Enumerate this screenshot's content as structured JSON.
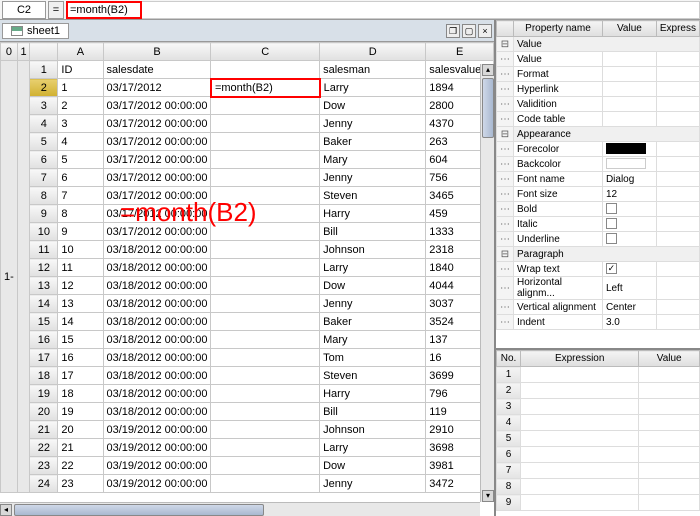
{
  "formula_bar": {
    "cell_ref": "C2",
    "eq": "=",
    "formula": "=month(B2)"
  },
  "sheet_tab": "sheet1",
  "overlay": "=month(B2)",
  "col_headers": [
    "A",
    "B",
    "C",
    "D",
    "E"
  ],
  "outline_headers": [
    "0",
    "1"
  ],
  "header_row": {
    "row": "1",
    "A": "ID",
    "B": "salesdate",
    "C": "",
    "D": "salesman",
    "E": "salesvalue"
  },
  "rows": [
    {
      "n": "2",
      "A": "1",
      "B": "03/17/2012",
      "C": "=month(B2)",
      "D": "Larry",
      "E": "1894"
    },
    {
      "n": "3",
      "A": "2",
      "B": "03/17/2012 00:00:00",
      "C": "",
      "D": "Dow",
      "E": "2800"
    },
    {
      "n": "4",
      "A": "3",
      "B": "03/17/2012 00:00:00",
      "C": "",
      "D": "Jenny",
      "E": "4370"
    },
    {
      "n": "5",
      "A": "4",
      "B": "03/17/2012 00:00:00",
      "C": "",
      "D": "Baker",
      "E": "263"
    },
    {
      "n": "6",
      "A": "5",
      "B": "03/17/2012 00:00:00",
      "C": "",
      "D": "Mary",
      "E": "604"
    },
    {
      "n": "7",
      "A": "6",
      "B": "03/17/2012 00:00:00",
      "C": "",
      "D": "Jenny",
      "E": "756"
    },
    {
      "n": "8",
      "A": "7",
      "B": "03/17/2012 00:00:00",
      "C": "",
      "D": "Steven",
      "E": "3465"
    },
    {
      "n": "9",
      "A": "8",
      "B": "03/17/2012 00:00:00",
      "C": "",
      "D": "Harry",
      "E": "459"
    },
    {
      "n": "10",
      "A": "9",
      "B": "03/17/2012 00:00:00",
      "C": "",
      "D": "Bill",
      "E": "1333"
    },
    {
      "n": "11",
      "A": "10",
      "B": "03/18/2012 00:00:00",
      "C": "",
      "D": "Johnson",
      "E": "2318"
    },
    {
      "n": "12",
      "A": "11",
      "B": "03/18/2012 00:00:00",
      "C": "",
      "D": "Larry",
      "E": "1840"
    },
    {
      "n": "13",
      "A": "12",
      "B": "03/18/2012 00:00:00",
      "C": "",
      "D": "Dow",
      "E": "4044"
    },
    {
      "n": "14",
      "A": "13",
      "B": "03/18/2012 00:00:00",
      "C": "",
      "D": "Jenny",
      "E": "3037"
    },
    {
      "n": "15",
      "A": "14",
      "B": "03/18/2012 00:00:00",
      "C": "",
      "D": "Baker",
      "E": "3524"
    },
    {
      "n": "16",
      "A": "15",
      "B": "03/18/2012 00:00:00",
      "C": "",
      "D": "Mary",
      "E": "137"
    },
    {
      "n": "17",
      "A": "16",
      "B": "03/18/2012 00:00:00",
      "C": "",
      "D": "Tom",
      "E": "16"
    },
    {
      "n": "18",
      "A": "17",
      "B": "03/18/2012 00:00:00",
      "C": "",
      "D": "Steven",
      "E": "3699"
    },
    {
      "n": "19",
      "A": "18",
      "B": "03/18/2012 00:00:00",
      "C": "",
      "D": "Harry",
      "E": "796"
    },
    {
      "n": "20",
      "A": "19",
      "B": "03/18/2012 00:00:00",
      "C": "",
      "D": "Bill",
      "E": "119"
    },
    {
      "n": "21",
      "A": "20",
      "B": "03/19/2012 00:00:00",
      "C": "",
      "D": "Johnson",
      "E": "2910"
    },
    {
      "n": "22",
      "A": "21",
      "B": "03/19/2012 00:00:00",
      "C": "",
      "D": "Larry",
      "E": "3698"
    },
    {
      "n": "23",
      "A": "22",
      "B": "03/19/2012 00:00:00",
      "C": "",
      "D": "Dow",
      "E": "3981"
    },
    {
      "n": "24",
      "A": "23",
      "B": "03/19/2012 00:00:00",
      "C": "",
      "D": "Jenny",
      "E": "3472"
    }
  ],
  "props": {
    "headers": [
      "Property name",
      "Value",
      "Express"
    ],
    "groups": [
      {
        "label": "Value",
        "items": [
          {
            "name": "Value",
            "val": ""
          },
          {
            "name": "Format",
            "val": ""
          },
          {
            "name": "Hyperlink",
            "val": ""
          },
          {
            "name": "Validition",
            "val": ""
          },
          {
            "name": "Code table",
            "val": ""
          }
        ]
      },
      {
        "label": "Appearance",
        "items": [
          {
            "name": "Forecolor",
            "val": "swatch-black"
          },
          {
            "name": "Backcolor",
            "val": "swatch-white"
          },
          {
            "name": "Font name",
            "val": "Dialog"
          },
          {
            "name": "Font size",
            "val": "12"
          },
          {
            "name": "Bold",
            "val": "chk"
          },
          {
            "name": "Italic",
            "val": "chk"
          },
          {
            "name": "Underline",
            "val": "chk"
          }
        ]
      },
      {
        "label": "Paragraph",
        "items": [
          {
            "name": "Wrap text",
            "val": "chk-on"
          },
          {
            "name": "Horizontal alignm...",
            "val": "Left"
          },
          {
            "name": "Vertical alignment",
            "val": "Center"
          },
          {
            "name": "Indent",
            "val": "3.0"
          }
        ]
      }
    ]
  },
  "expr": {
    "headers": [
      "No.",
      "Expression",
      "Value"
    ],
    "rows": [
      "1",
      "2",
      "3",
      "4",
      "5",
      "6",
      "7",
      "8",
      "9"
    ]
  }
}
